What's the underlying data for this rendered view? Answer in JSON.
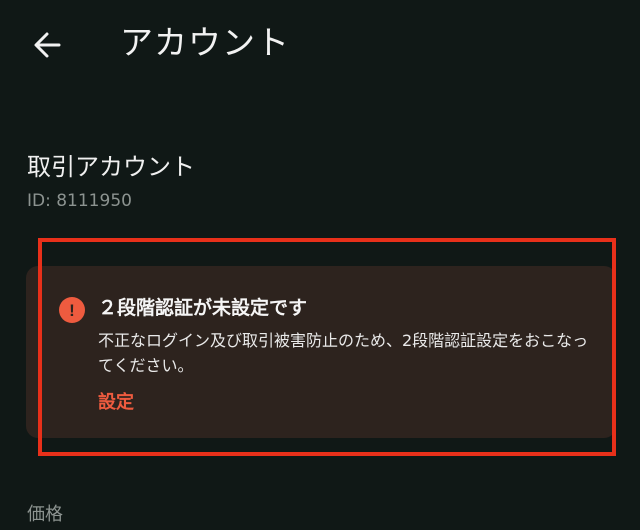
{
  "header": {
    "title": "アカウント",
    "back_icon": "arrow-left-icon"
  },
  "account": {
    "heading": "取引アカウント",
    "id_text": "ID: 8111950"
  },
  "alert": {
    "icon": "exclamation-circle-icon",
    "title": "２段階認証が未設定です",
    "body": "不正なログイン及び取引被害防止のため、2段階認証設定をおこなってください。",
    "link_label": "設定",
    "accent_color": "#ee5b3f",
    "highlight_color": "#e8301a"
  },
  "section": {
    "price_label": "価格"
  }
}
